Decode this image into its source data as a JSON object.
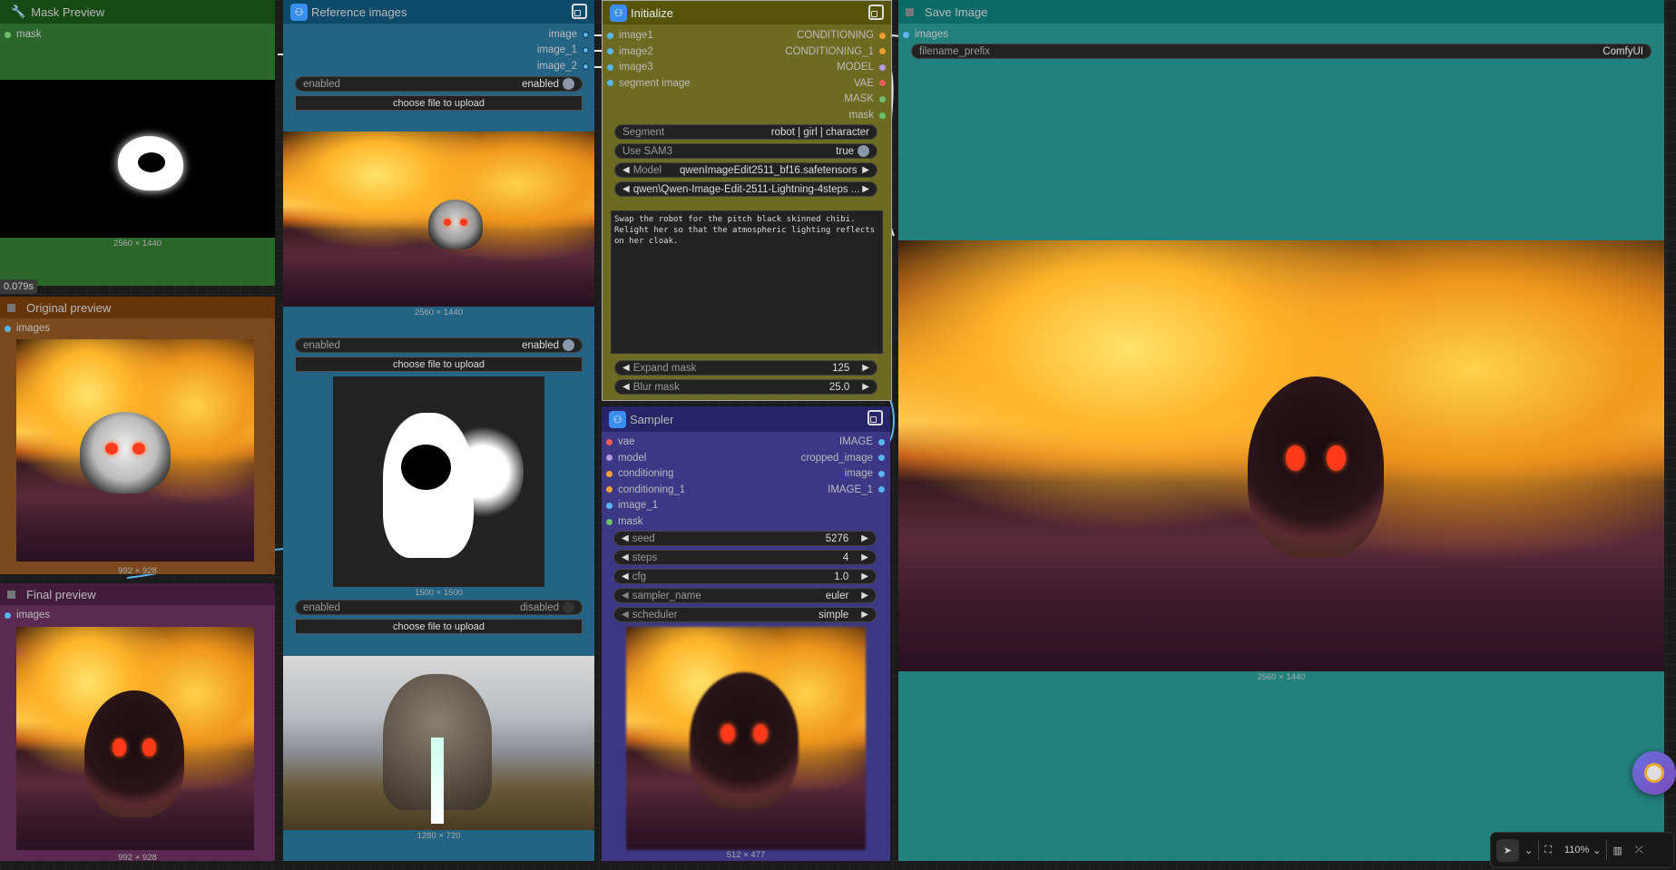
{
  "mask_preview": {
    "title": "Mask Preview",
    "input": "mask",
    "caption": "2560 × 1440",
    "timing": "0.079s"
  },
  "original_preview": {
    "title": "Original preview",
    "input": "images",
    "caption": "992 × 928"
  },
  "final_preview": {
    "title": "Final preview",
    "input": "images",
    "caption": "992 × 928"
  },
  "reference_images": {
    "title": "Reference images",
    "outputs": [
      "image",
      "image_1",
      "image_2"
    ],
    "groups": [
      {
        "toggle_label": "enabled",
        "toggle_value": "enabled",
        "on": true,
        "upload": "choose file to upload",
        "caption": "2560 × 1440"
      },
      {
        "toggle_label": "enabled",
        "toggle_value": "enabled",
        "on": true,
        "upload": "choose file to upload",
        "caption": "1500 × 1500"
      },
      {
        "toggle_label": "enabled",
        "toggle_value": "disabled",
        "on": false,
        "upload": "choose file to upload",
        "caption": "1280 × 720"
      }
    ]
  },
  "initialize": {
    "title": "Initialize",
    "inputs": [
      "image1",
      "image2",
      "image3",
      "segment image"
    ],
    "outputs": [
      "CONDITIONING",
      "CONDITIONING_1",
      "MODEL",
      "VAE",
      "MASK",
      "mask"
    ],
    "segment": {
      "label": "Segment",
      "value": "robot | girl | character"
    },
    "use_sam3": {
      "label": "Use SAM3",
      "value": "true"
    },
    "model": {
      "label": "Model",
      "value": "qwenImageEdit2511_bf16.safetensors"
    },
    "lora": {
      "value": "qwen\\Qwen-Image-Edit-2511-Lightning-4steps ..."
    },
    "prompt": "Swap the robot for the pitch black skinned chibi. Relight her so that the atmospheric lighting reflects on her cloak.",
    "expand_mask": {
      "label": "Expand mask",
      "value": "125"
    },
    "blur_mask": {
      "label": "Blur mask",
      "value": "25.0"
    }
  },
  "sampler": {
    "title": "Sampler",
    "inputs": [
      "vae",
      "model",
      "conditioning",
      "conditioning_1",
      "image_1",
      "mask"
    ],
    "outputs": [
      "IMAGE",
      "cropped_image",
      "image",
      "IMAGE_1"
    ],
    "widgets": [
      {
        "label": "seed",
        "value": "5276"
      },
      {
        "label": "steps",
        "value": "4"
      },
      {
        "label": "cfg",
        "value": "1.0"
      },
      {
        "label": "sampler_name",
        "value": "euler"
      },
      {
        "label": "scheduler",
        "value": "simple"
      }
    ],
    "caption": "512 × 477"
  },
  "save_image": {
    "title": "Save Image",
    "input": "images",
    "filename_prefix": {
      "label": "filename_prefix",
      "value": "ComfyUI"
    },
    "caption": "2560 × 1440"
  },
  "toolbar": {
    "zoom": "110%"
  },
  "colors": {
    "image": "#5ab4f0",
    "conditioning": "#f0a030",
    "model": "#b49ae0",
    "vae": "#f05a5a",
    "mask": "#6cc070"
  }
}
